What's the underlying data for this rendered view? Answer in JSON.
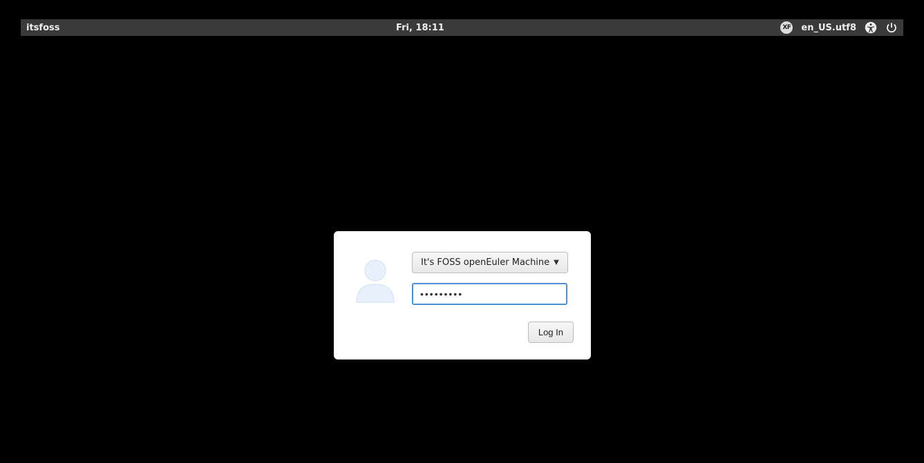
{
  "topbar": {
    "hostname": "itsfoss",
    "datetime": "Fri, 18:11",
    "locale": "en_US.utf8"
  },
  "login": {
    "user_selected": "It's FOSS openEuler Machine",
    "password_value": "•••••••••",
    "login_button_label": "Log In"
  }
}
